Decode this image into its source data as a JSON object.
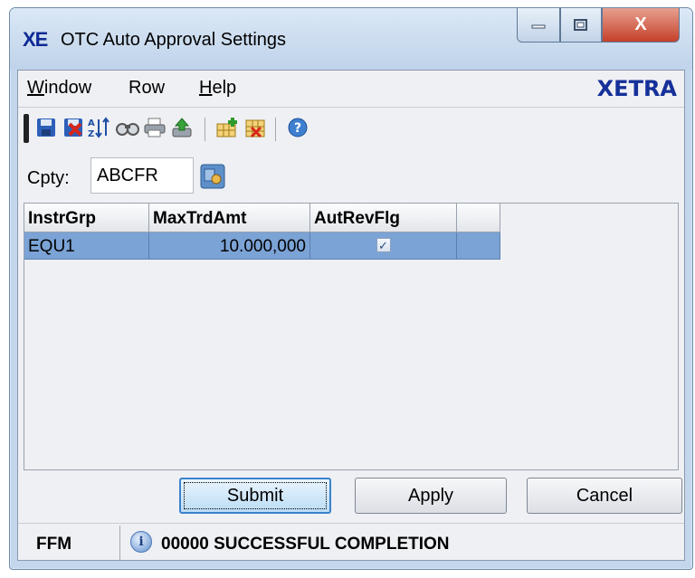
{
  "window": {
    "logo": "XE",
    "title": "OTC Auto Approval Settings",
    "close_glyph": "X"
  },
  "menu": {
    "items": [
      {
        "label": "Window",
        "mnemonic_index": 0
      },
      {
        "label": "Row",
        "mnemonic_index": -1
      },
      {
        "label": "Help",
        "mnemonic_index": 0
      }
    ],
    "brand": "XETRA"
  },
  "toolbar": {
    "icons": [
      "save-icon",
      "delete-save-icon",
      "sort-icon",
      "find-icon",
      "print-icon",
      "export-icon",
      "add-row-icon",
      "delete-row-icon",
      "help-icon"
    ]
  },
  "filter": {
    "label": "Cpty:",
    "value": "ABCFR"
  },
  "grid": {
    "columns": [
      "InstrGrp",
      "MaxTrdAmt",
      "AutRevFlg",
      ""
    ],
    "rows": [
      {
        "instr_grp": "EQU1",
        "max_trd_amt": "10.000,000",
        "aut_rev_flg": true
      }
    ]
  },
  "buttons": {
    "submit": "Submit",
    "apply": "Apply",
    "cancel": "Cancel"
  },
  "status": {
    "tag": "FFM",
    "message": "00000 SUCCESSFUL COMPLETION"
  },
  "colors": {
    "selected_row": "#7ba3d6",
    "brand": "#16309a",
    "logo": "#0e2a94"
  }
}
